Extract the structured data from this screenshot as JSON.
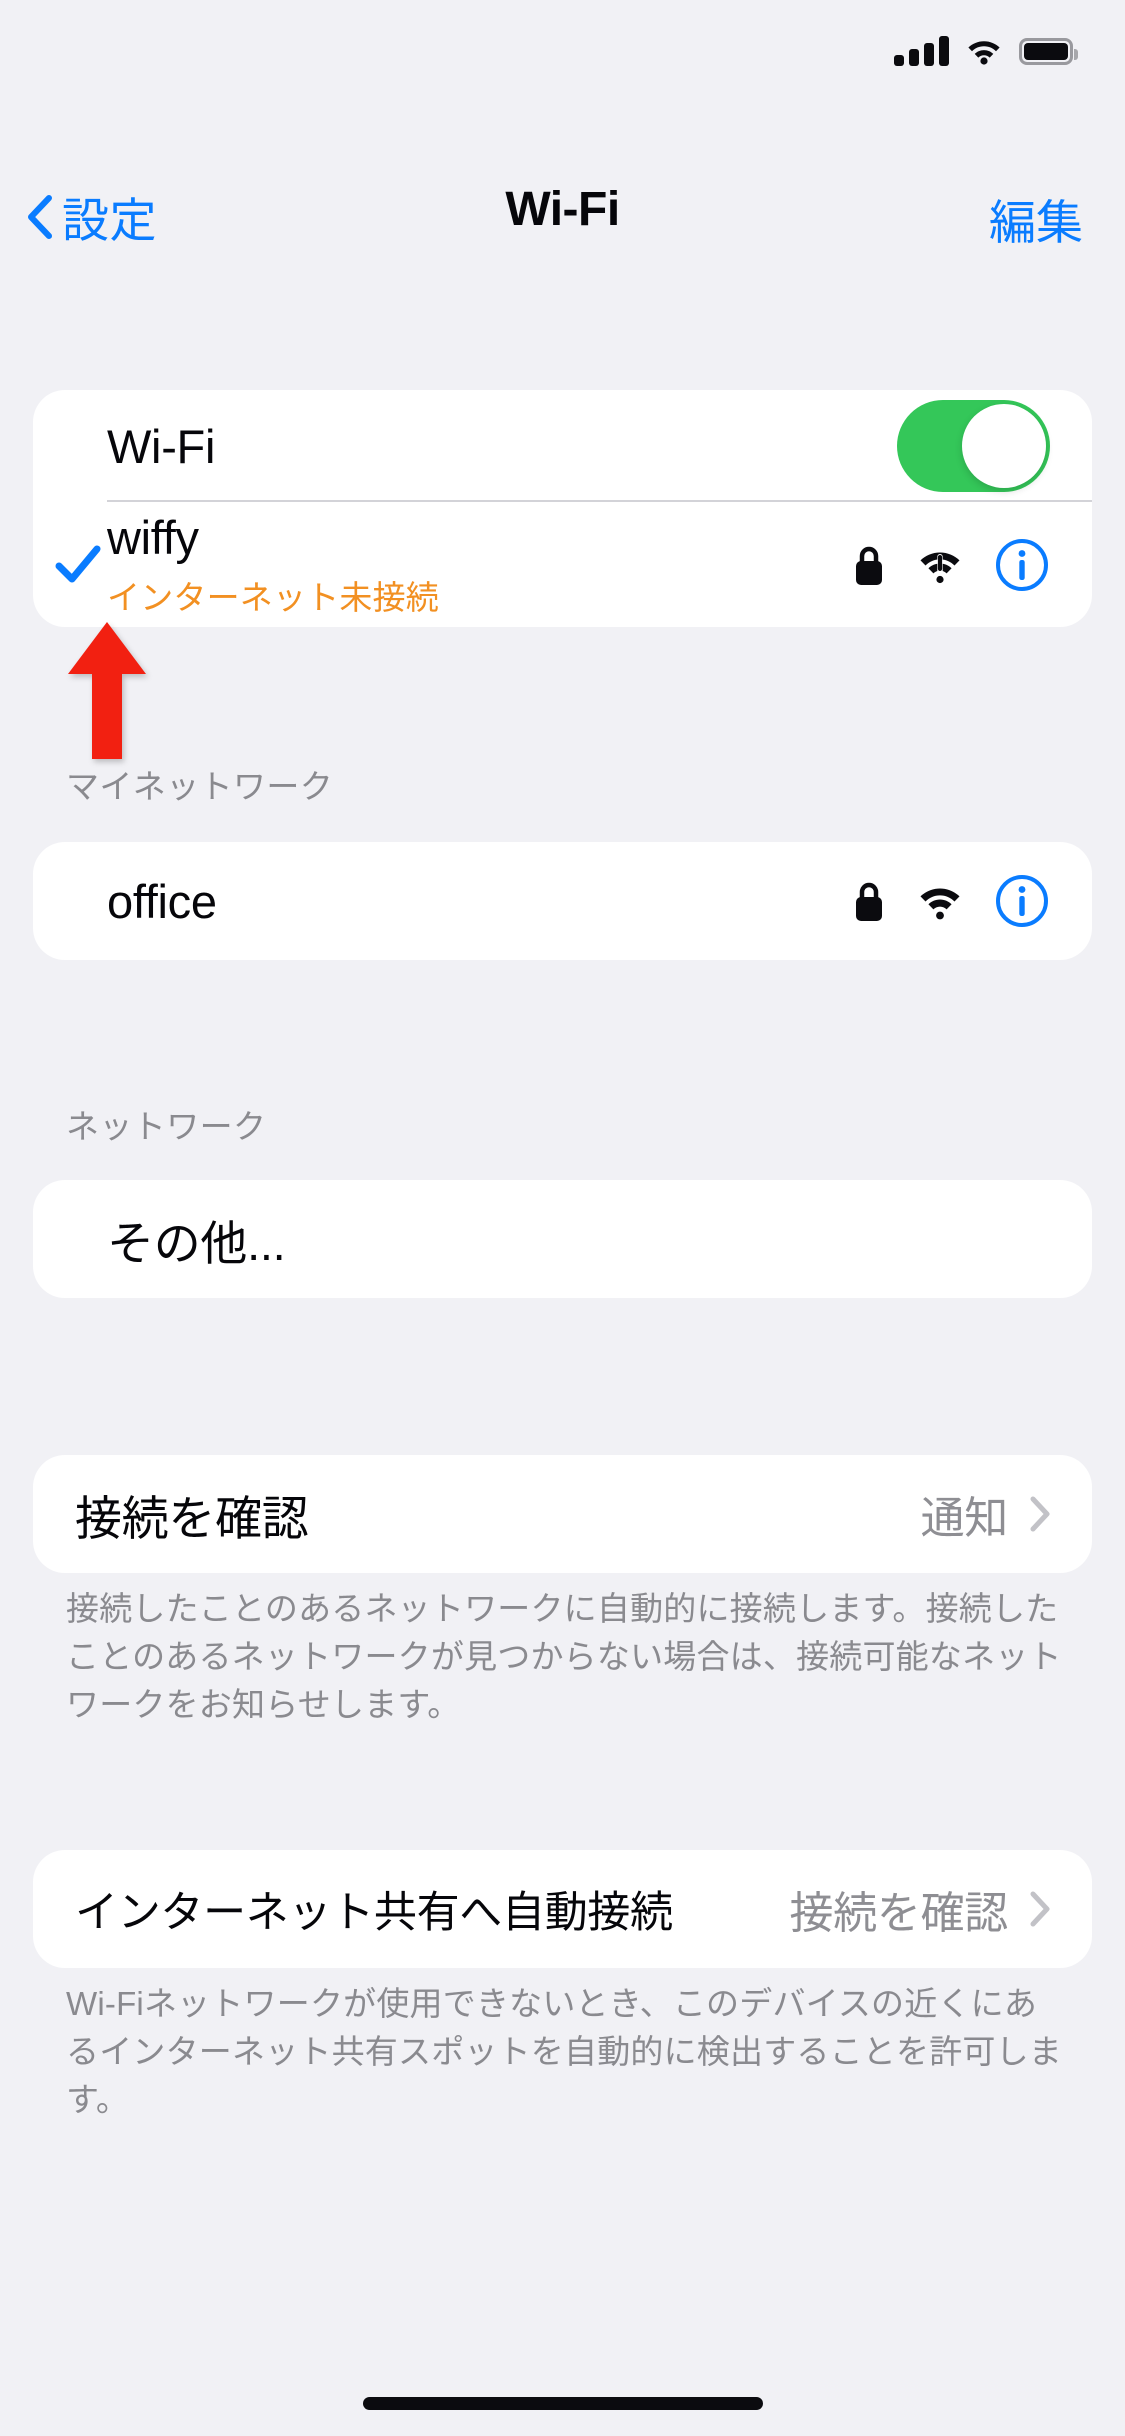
{
  "status_bar": {
    "cellular_icon": "cellular-signal-icon",
    "wifi_icon": "wifi-icon",
    "battery_icon": "battery-full-icon"
  },
  "nav": {
    "back_label": "設定",
    "back_icon": "chevron-left-icon",
    "title": "Wi-Fi",
    "edit_label": "編集"
  },
  "wifi_toggle": {
    "label": "Wi-Fi",
    "state": "on",
    "accent_color": "#34c759"
  },
  "connected_network": {
    "name": "wiffy",
    "subtitle": "インターネット未接続",
    "subtitle_color": "#f29022",
    "checked": true,
    "check_color": "#0a7cff",
    "lock_icon": "lock-icon",
    "signal_icon": "wifi-exclamation-icon",
    "info_icon": "info-circle-icon"
  },
  "my_networks": {
    "header": "マイネットワーク",
    "items": [
      {
        "name": "office",
        "lock_icon": "lock-icon",
        "signal_icon": "wifi-icon",
        "info_icon": "info-circle-icon"
      }
    ]
  },
  "networks": {
    "header": "ネットワーク",
    "other_label": "その他..."
  },
  "ask_to_join": {
    "label": "接続を確認",
    "value": "通知",
    "chevron_icon": "chevron-right-icon",
    "footer": "接続したことのあるネットワークに自動的に接続します。接続したことのあるネットワークが見つからない場合は、接続可能なネットワークをお知らせします。"
  },
  "auto_join_hotspot": {
    "label": "インターネット共有へ自動接続",
    "value": "接続を確認",
    "chevron_icon": "chevron-right-icon",
    "footer": "Wi-Fiネットワークが使用できないとき、このデバイスの近くにあるインターネット共有スポットを自動的に検出することを許可します。"
  },
  "annotation": {
    "arrow_icon": "red-up-arrow-annotation",
    "color": "#f22011"
  }
}
